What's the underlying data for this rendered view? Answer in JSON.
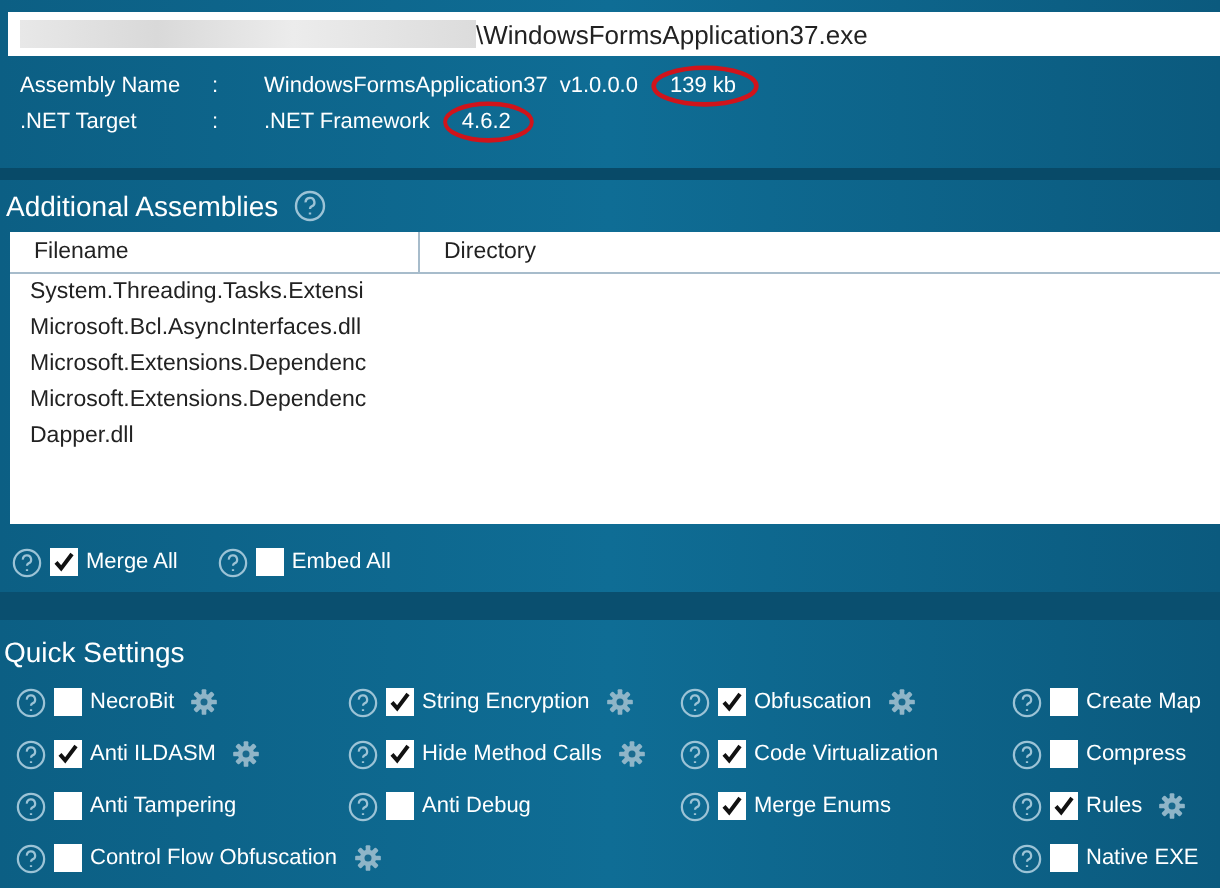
{
  "file_path": {
    "value": "\\WindowsFormsApplication37.exe",
    "redacted_prefix": true
  },
  "info": [
    {
      "label": "Assembly Name",
      "separator": ":",
      "value": "WindowsFormsApplication37",
      "version": "v1.0.0.0",
      "extra": "139 kb",
      "extra_circled": true
    },
    {
      "label": ".NET Target",
      "separator": ":",
      "value": ".NET Framework",
      "extra": "4.6.2",
      "extra_circled": true
    }
  ],
  "additional_assemblies": {
    "title": "Additional Assemblies",
    "columns": [
      "Filename",
      "Directory"
    ],
    "rows": [
      {
        "filename": "System.Threading.Tasks.Extensi"
      },
      {
        "filename": "Microsoft.Bcl.AsyncInterfaces.dll"
      },
      {
        "filename": "Microsoft.Extensions.Dependenc"
      },
      {
        "filename": "Microsoft.Extensions.Dependenc"
      },
      {
        "filename": "Dapper.dll"
      }
    ],
    "options": [
      {
        "label": "Merge All",
        "checked": true
      },
      {
        "label": "Embed All",
        "checked": false
      }
    ]
  },
  "quick_settings": {
    "title": "Quick Settings",
    "columns": [
      [
        {
          "label": "NecroBit",
          "checked": false,
          "gear": true
        },
        {
          "label": "Anti ILDASM",
          "checked": true,
          "gear": true
        },
        {
          "label": "Anti Tampering",
          "checked": false,
          "gear": false
        },
        {
          "label": "Control Flow Obfuscation",
          "checked": false,
          "gear": true
        }
      ],
      [
        {
          "label": "String Encryption",
          "checked": true,
          "gear": true
        },
        {
          "label": "Hide Method Calls",
          "checked": true,
          "gear": true
        },
        {
          "label": "Anti Debug",
          "checked": false,
          "gear": false
        }
      ],
      [
        {
          "label": "Obfuscation",
          "checked": true,
          "gear": true
        },
        {
          "label": "Code Virtualization",
          "checked": true,
          "gear": false
        },
        {
          "label": "Merge Enums",
          "checked": true,
          "gear": false
        }
      ],
      [
        {
          "label": "Create Map",
          "checked": false,
          "gear": false
        },
        {
          "label": "Compress",
          "checked": false,
          "gear": false
        },
        {
          "label": "Rules",
          "checked": true,
          "gear": true
        },
        {
          "label": "Native EXE",
          "checked": false,
          "gear": false
        }
      ]
    ]
  }
}
